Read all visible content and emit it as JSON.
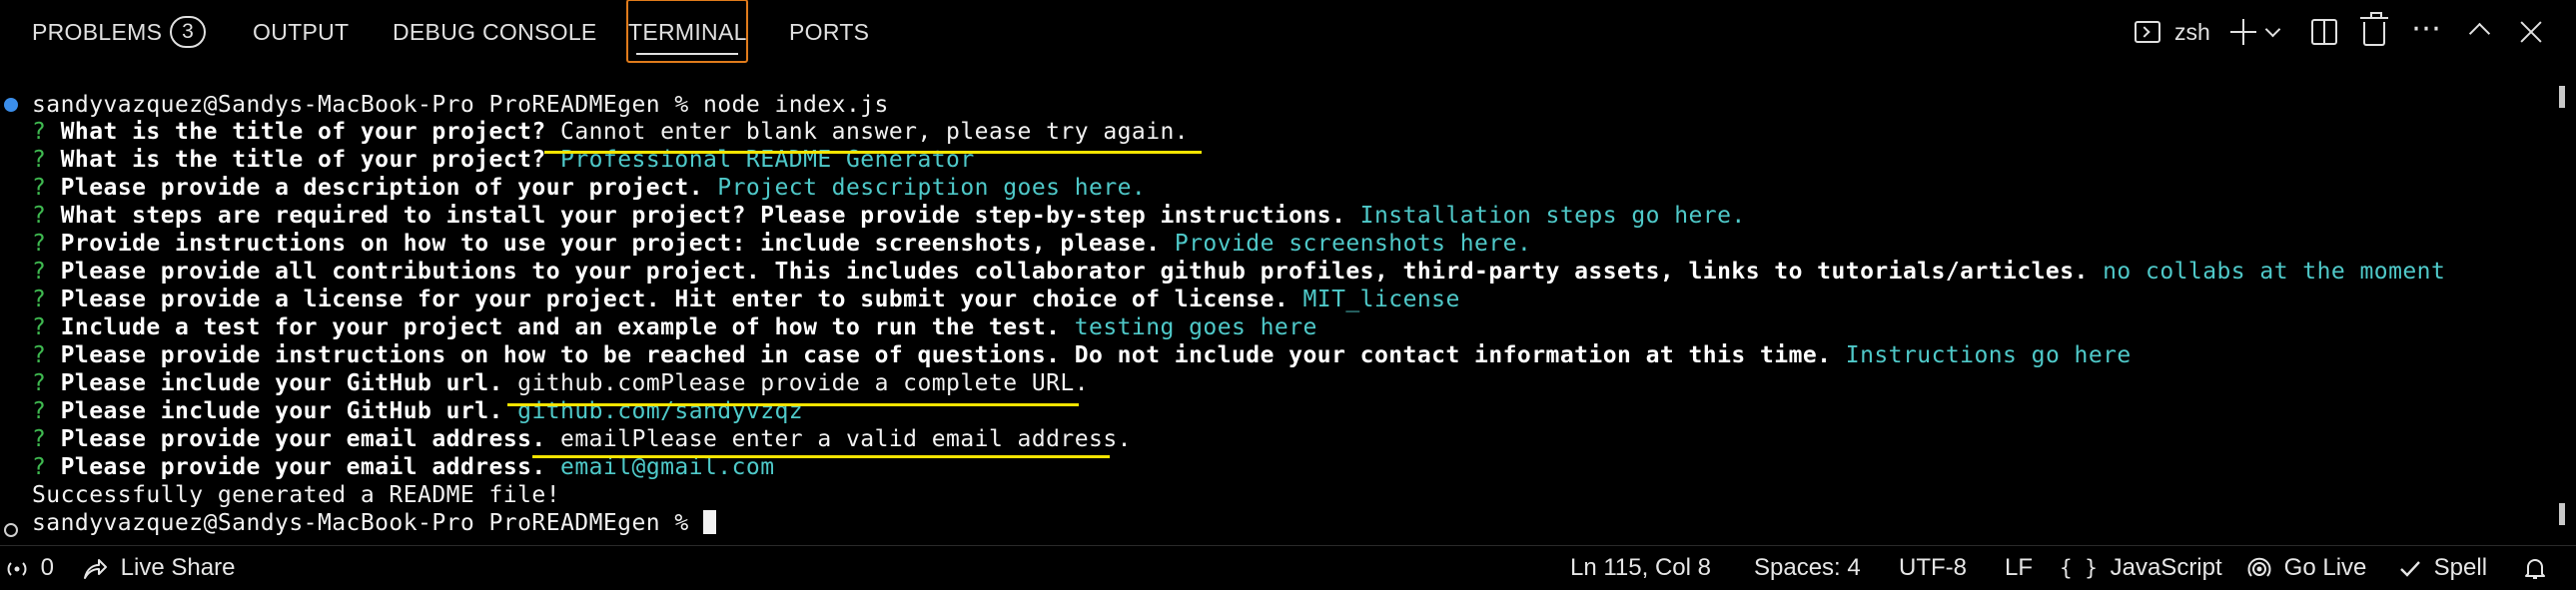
{
  "panel": {
    "tabs": {
      "problems": "PROBLEMS",
      "problems_count": "3",
      "output": "OUTPUT",
      "debug_console": "DEBUG CONSOLE",
      "terminal": "TERMINAL",
      "ports": "PORTS"
    },
    "active_tab": "TERMINAL",
    "shell_label": "zsh",
    "more_icon": "⋯",
    "accent_color": "#e07b1b"
  },
  "terminal": {
    "command_line": "sandyvazquez@Sandys-MacBook-Pro ProREADMEgen % node index.js",
    "lines": [
      {
        "q": "?",
        "question": "What is the title of your project?",
        "answer": "",
        "error": " Cannot enter blank answer, please try again."
      },
      {
        "q": "?",
        "question": "What is the title of your project?",
        "answer": " Professional README Generator",
        "error": ""
      },
      {
        "q": "?",
        "question": "Please provide a description of your project.",
        "answer": " Project description goes here.",
        "error": ""
      },
      {
        "q": "?",
        "question": "What steps are required to install your project? Please provide step-by-step instructions.",
        "answer": " Installation steps go here.",
        "error": ""
      },
      {
        "q": "?",
        "question": "Provide instructions on how to use your project: include screenshots, please.",
        "answer": " Provide screenshots here.",
        "error": ""
      },
      {
        "q": "?",
        "question": "Please provide all contributions to your project. This includes collaborator github profiles, third-party assets, links to tutorials/articles.",
        "answer": " no collabs at the moment",
        "error": ""
      },
      {
        "q": "?",
        "question": "Please provide a license for your project. Hit enter to submit your choice of license.",
        "answer": " MIT_license",
        "error": ""
      },
      {
        "q": "?",
        "question": "Include a test for your project and an example of how to run the test.",
        "answer": " testing goes here",
        "error": ""
      },
      {
        "q": "?",
        "question": "Please provide instructions on how to be reached in case of questions. Do not include your contact information at this time.",
        "answer": " Instructions go here",
        "error": ""
      },
      {
        "q": "?",
        "question": "Please include your GitHub url.",
        "answer": "",
        "error": " github.comPlease provide a complete URL."
      },
      {
        "q": "?",
        "question": "Please include your GitHub url.",
        "answer": " github.com/sandyvzqz",
        "error": ""
      },
      {
        "q": "?",
        "question": "Please provide your email address.",
        "answer": "",
        "error": " emailPlease enter a valid email address."
      },
      {
        "q": "?",
        "question": "Please provide your email address.",
        "answer": " email@gmail.com",
        "error": ""
      }
    ],
    "success_message": "Successfully generated a README file!",
    "final_prompt": "sandyvazquez@Sandys-MacBook-Pro ProREADMEgen % ",
    "colors": {
      "question_mark": "#3fb950",
      "answer": "#4fc9c9",
      "highlight_underline": "#f5e400",
      "command_marker": "#3b8eea"
    }
  },
  "status_bar": {
    "ports_count": "0",
    "live_share": "Live Share",
    "cursor_position": "Ln 115, Col 8",
    "indentation": "Spaces: 4",
    "encoding": "UTF-8",
    "line_ending": "LF",
    "language_braces": "{ }",
    "language": "JavaScript",
    "go_live": "Go Live",
    "spell": "Spell"
  }
}
